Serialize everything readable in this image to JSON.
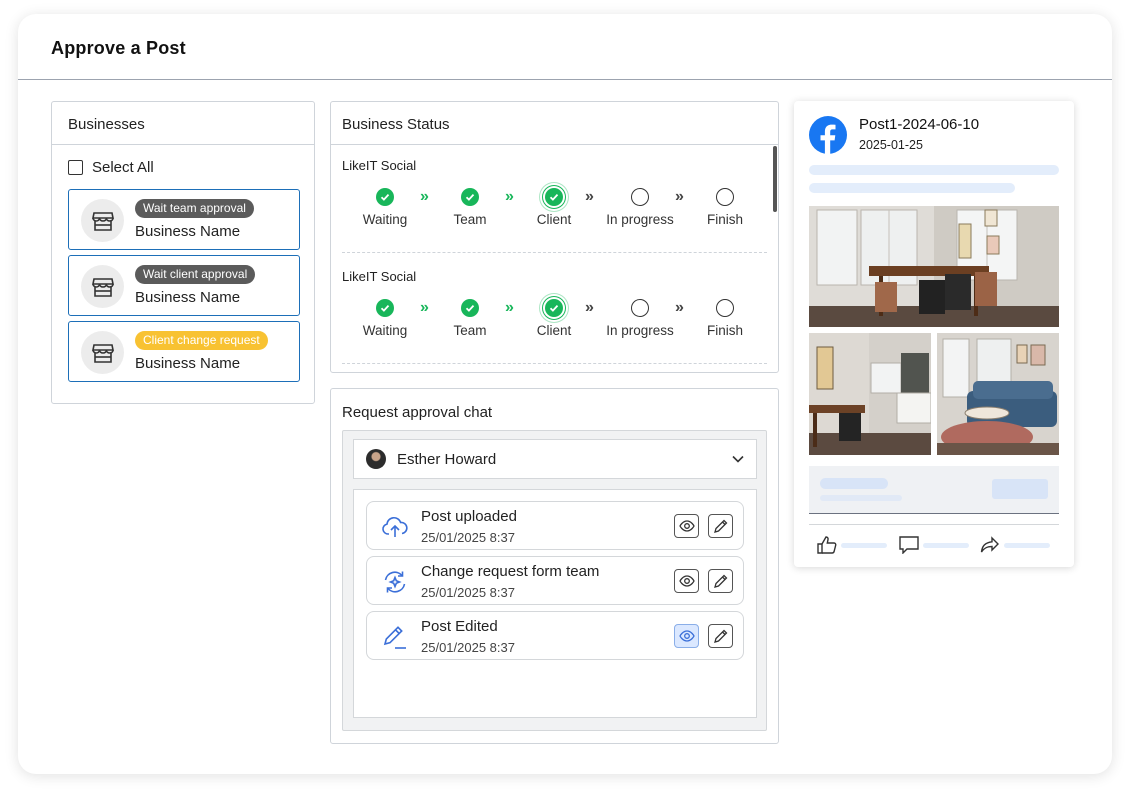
{
  "page": {
    "title": "Approve a Post"
  },
  "businesses": {
    "title": "Businesses",
    "select_all": "Select All",
    "items": [
      {
        "badge": "Wait team approval",
        "badge_color": "#5b5b5b",
        "name": "Business Name"
      },
      {
        "badge": "Wait client approval",
        "badge_color": "#5b5b5b",
        "name": "Business Name"
      },
      {
        "badge": "Client change request",
        "badge_color": "#f8c232",
        "name": "Business Name"
      }
    ]
  },
  "status": {
    "title": "Business Status",
    "rows": [
      {
        "name": "LikeIT Social",
        "steps": [
          {
            "label": "Waiting",
            "state": "done"
          },
          {
            "label": "Team",
            "state": "done"
          },
          {
            "label": "Client",
            "state": "current"
          },
          {
            "label": "In progress",
            "state": "pending"
          },
          {
            "label": "Finish",
            "state": "pending"
          }
        ]
      },
      {
        "name": "LikeIT Social",
        "steps": [
          {
            "label": "Waiting",
            "state": "done"
          },
          {
            "label": "Team",
            "state": "done"
          },
          {
            "label": "Client",
            "state": "current"
          },
          {
            "label": "In progress",
            "state": "pending"
          },
          {
            "label": "Finish",
            "state": "pending"
          }
        ]
      }
    ],
    "done_color": "#18b65a"
  },
  "chat": {
    "title": "Request approval chat",
    "person": "Esther Howard",
    "messages": [
      {
        "icon": "cloud-upload-icon",
        "title": "Post uploaded",
        "time": "25/01/2025 8:37",
        "viewed": false
      },
      {
        "icon": "refresh-sparkle-icon",
        "title": "Change request form team",
        "time": "25/01/2025 8:37",
        "viewed": false
      },
      {
        "icon": "pen-edit-icon",
        "title": "Post Edited",
        "time": "25/01/2025 8:37",
        "viewed": true
      }
    ]
  },
  "preview": {
    "platform_icon": "facebook-icon",
    "post_title": "Post1-2024-06-10",
    "post_date": "2025-01-25",
    "actions": [
      "like-icon",
      "comment-icon",
      "share-icon"
    ]
  }
}
